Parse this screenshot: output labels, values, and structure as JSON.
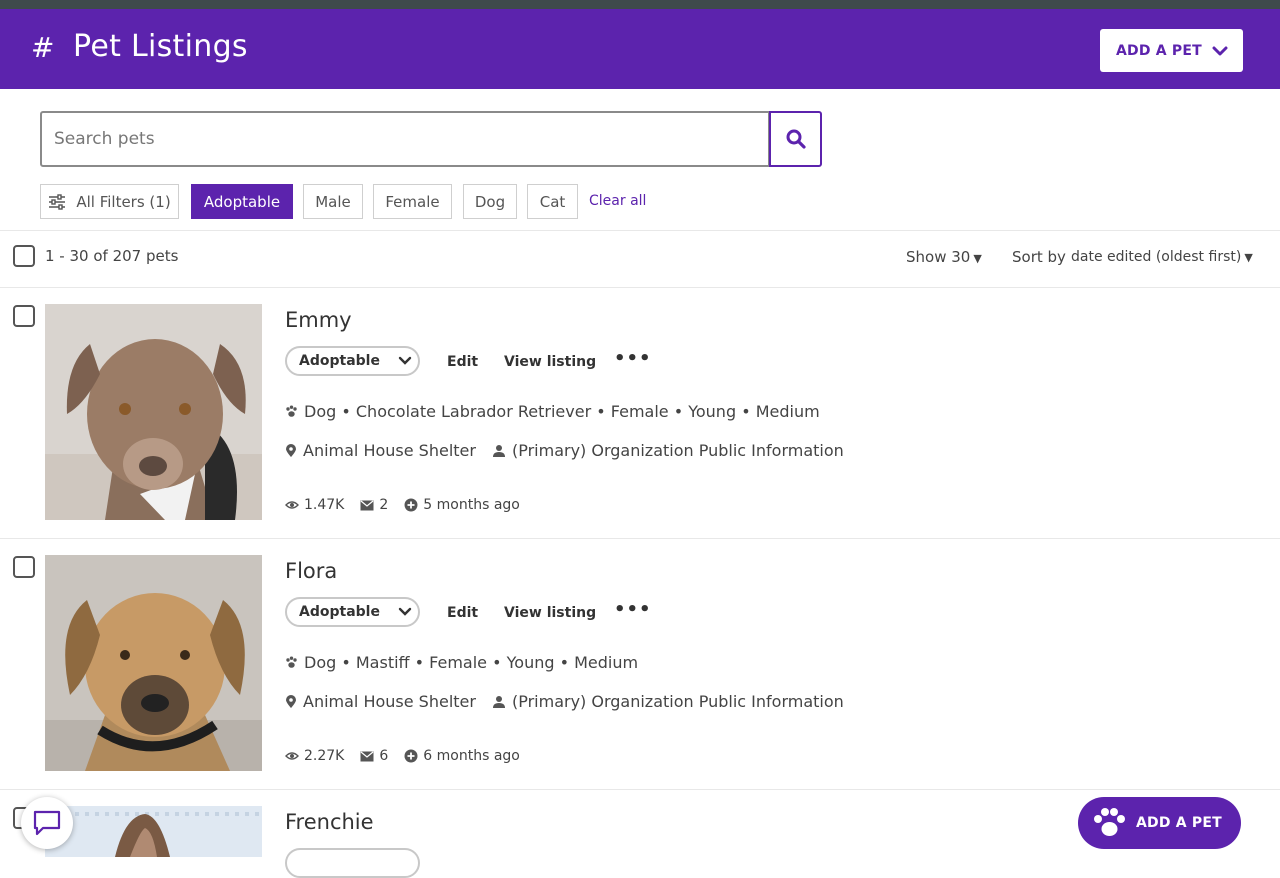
{
  "header": {
    "hash": "#",
    "title": "Pet Listings",
    "add_button": "ADD A PET"
  },
  "search": {
    "placeholder": "Search pets"
  },
  "filters": {
    "all_filters": "All Filters (1)",
    "chips": [
      "Adoptable",
      "Male",
      "Female",
      "Dog",
      "Cat"
    ],
    "active_chip": "Adoptable",
    "clear_all": "Clear all"
  },
  "results": {
    "count": "1 - 30 of 207 pets",
    "show": "Show 30",
    "sort_label": "Sort by",
    "sort_value": "date edited (oldest first)"
  },
  "pets": [
    {
      "name": "Emmy",
      "status": "Adoptable",
      "edit": "Edit",
      "view": "View listing",
      "details": "Dog • Chocolate Labrador Retriever • Female • Young • Medium",
      "shelter": "Animal House Shelter",
      "contact": "(Primary) Organization Public Information",
      "views": "1.47K",
      "messages": "2",
      "added": "5 months ago"
    },
    {
      "name": "Flora",
      "status": "Adoptable",
      "edit": "Edit",
      "view": "View listing",
      "details": "Dog • Mastiff • Female • Young • Medium",
      "shelter": "Animal House Shelter",
      "contact": "(Primary) Organization Public Information",
      "views": "2.27K",
      "messages": "6",
      "added": "6 months ago"
    },
    {
      "name": "Frenchie"
    }
  ],
  "fab": {
    "label": "ADD A PET"
  },
  "colors": {
    "brand": "#5c23ad",
    "header_bg": "#5c23ad"
  },
  "icons": [
    "hash-icon",
    "chevron-down-icon",
    "search-icon",
    "sliders-icon",
    "paw-icon",
    "location-pin-icon",
    "person-icon",
    "eye-icon",
    "envelope-icon",
    "plus-circle-icon",
    "chat-icon"
  ]
}
